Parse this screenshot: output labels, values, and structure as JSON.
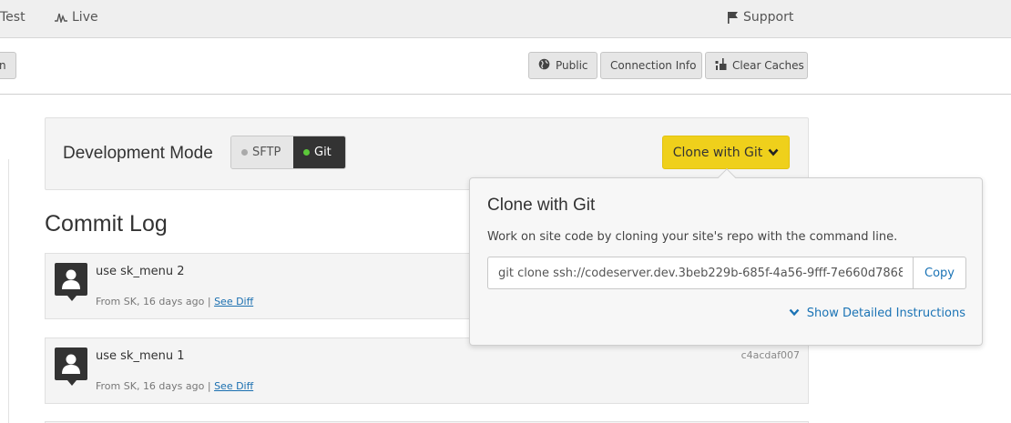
{
  "topnav": {
    "test_label": "Test",
    "live_label": "Live",
    "support_label": "Support"
  },
  "toolbar": {
    "cut_label": "n",
    "public_label": "Public",
    "connection_label": "Connection Info",
    "clear_caches_label": "Clear Caches"
  },
  "dev_mode": {
    "title": "Development Mode",
    "sftp_label": "SFTP",
    "git_label": "Git",
    "selected": "Git",
    "clone_button_label": "Clone with Git"
  },
  "commit_log": {
    "title": "Commit Log",
    "commits": [
      {
        "message": "use sk_menu 2",
        "meta": "From SK, 16 days ago |",
        "diff_label": "See Diff",
        "hash": ""
      },
      {
        "message": "use sk_menu 1",
        "meta": "From SK, 16 days ago |",
        "diff_label": "See Diff",
        "hash": "c4acdaf007"
      }
    ]
  },
  "clone_popover": {
    "title": "Clone with Git",
    "description": "Work on site code by cloning your site's repo with the command line.",
    "command": "git clone ssh://codeserver.dev.3beb229b-685f-4a56-9fff-7e660d7868",
    "copy_label": "Copy",
    "details_label": "Show Detailed Instructions"
  },
  "colors": {
    "accent_yellow": "#efd01b",
    "link_blue": "#1a73b5",
    "git_dot_green": "#5cc83a"
  },
  "icons": [
    "live-pulse-icon",
    "flag-icon",
    "globe-icon",
    "broom-icon",
    "chevron-down-icon",
    "user-avatar-icon"
  ]
}
